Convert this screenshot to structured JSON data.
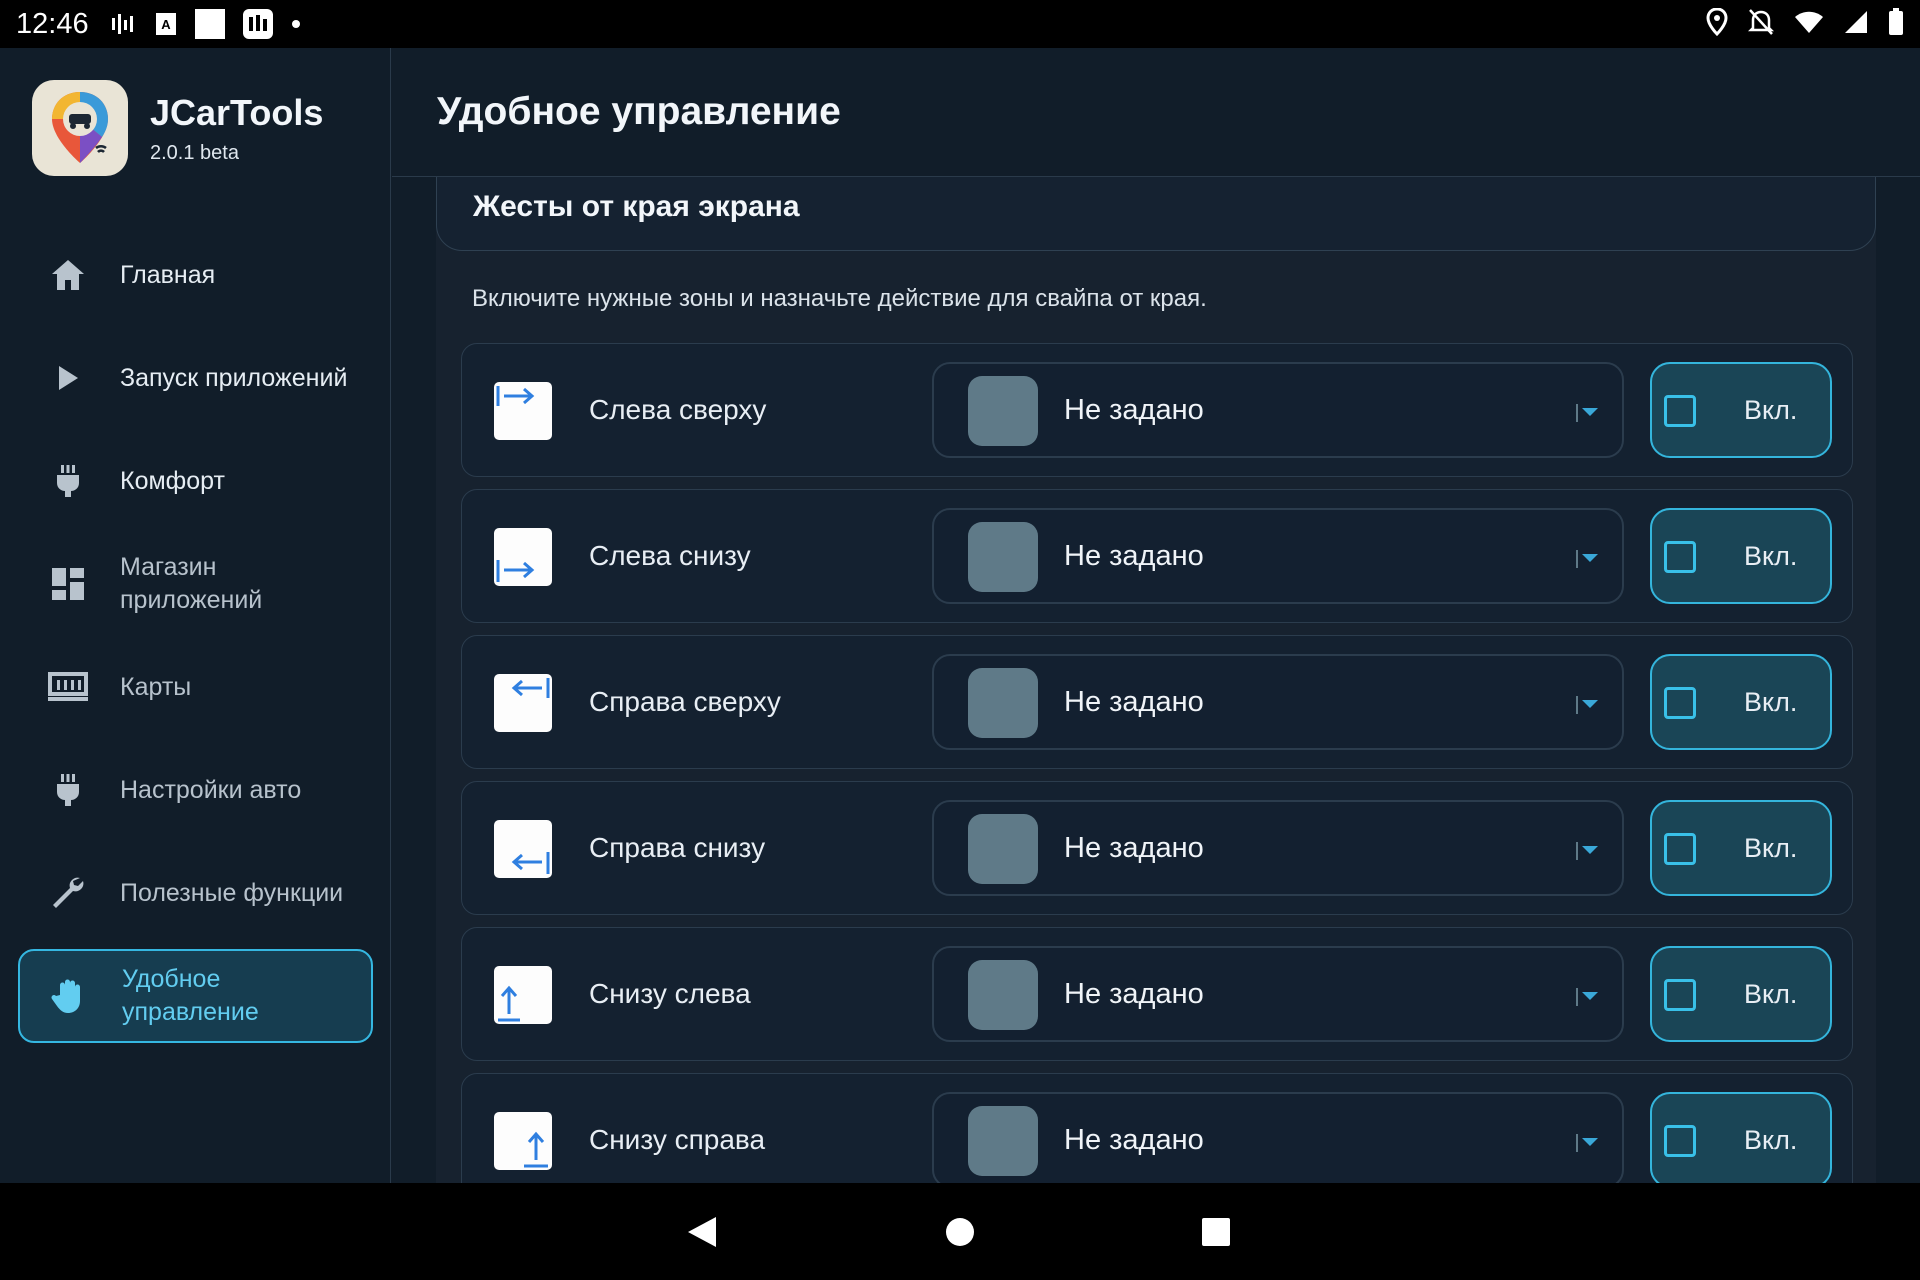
{
  "status_bar": {
    "time": "12:46",
    "left_icons": [
      "signal-bars-icon",
      "font-a-icon",
      "white-square-icon",
      "app-notification-icon",
      "dot-icon"
    ],
    "right_icons": [
      "location-icon",
      "notifications-off-icon",
      "wifi-icon",
      "cellular-icon",
      "battery-icon"
    ]
  },
  "app": {
    "name": "JCarTools",
    "version": "2.0.1 beta"
  },
  "sidebar": {
    "items": [
      {
        "label": "Главная",
        "icon": "home-icon"
      },
      {
        "label": "Запуск приложений",
        "icon": "play-icon"
      },
      {
        "label": "Комфорт",
        "icon": "plug-icon"
      },
      {
        "label": "Магазин\nприложений",
        "icon": "dashboard-icon"
      },
      {
        "label": "Карты",
        "icon": "map-icon"
      },
      {
        "label": "Настройки авто",
        "icon": "plug-icon"
      },
      {
        "label": "Полезные функции",
        "icon": "wrench-icon"
      },
      {
        "label": "Удобное\nуправление",
        "icon": "hand-icon",
        "active": true
      }
    ]
  },
  "main": {
    "title": "Удобное управление",
    "card": {
      "title": "Жесты от края экрана",
      "description": "Включите нужные зоны и назначьте действие для свайпа от края.",
      "rows": [
        {
          "label": "Слева сверху",
          "icon": "arrow-right-from-left-top-icon",
          "action": "Не задано",
          "toggle": "Вкл.",
          "checked": false
        },
        {
          "label": "Слева снизу",
          "icon": "arrow-right-from-left-bottom-icon",
          "action": "Не задано",
          "toggle": "Вкл.",
          "checked": false
        },
        {
          "label": "Справа сверху",
          "icon": "arrow-left-from-right-top-icon",
          "action": "Не задано",
          "toggle": "Вкл.",
          "checked": false
        },
        {
          "label": "Справа снизу",
          "icon": "arrow-left-from-right-bottom-icon",
          "action": "Не задано",
          "toggle": "Вкл.",
          "checked": false
        },
        {
          "label": "Снизу слева",
          "icon": "arrow-up-from-bottom-left-icon",
          "action": "Не задано",
          "toggle": "Вкл.",
          "checked": false
        },
        {
          "label": "Снизу справа",
          "icon": "arrow-up-from-bottom-right-icon",
          "action": "Не задано",
          "toggle": "Вкл.",
          "checked": false
        }
      ]
    }
  },
  "colors": {
    "background": "#111d29",
    "accent": "#35b7e1",
    "active_text": "#62cdf0",
    "swatch": "#5f7a88",
    "icon_blue": "#2f7fe0"
  }
}
